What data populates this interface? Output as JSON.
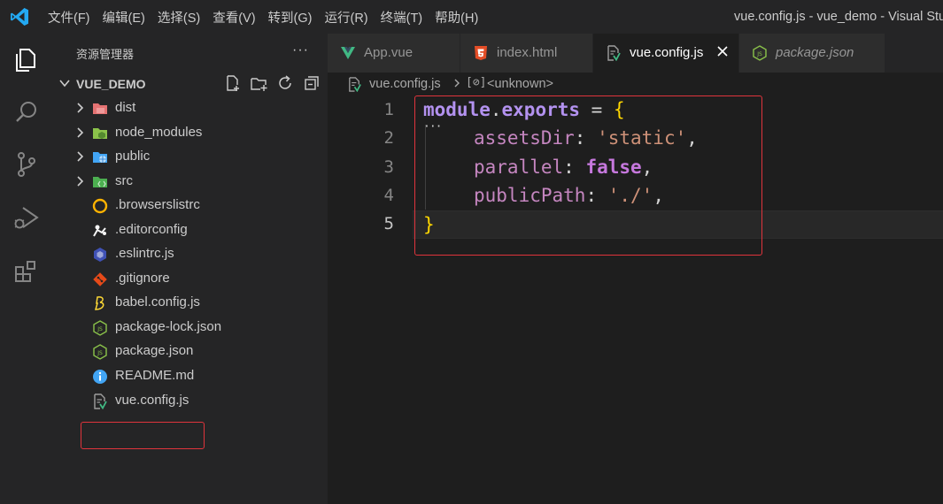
{
  "titlebar": {
    "menu": [
      "文件(F)",
      "编辑(E)",
      "选择(S)",
      "查看(V)",
      "转到(G)",
      "运行(R)",
      "终端(T)",
      "帮助(H)"
    ],
    "window_title": "vue.config.js - vue_demo - Visual Studio"
  },
  "sidebar": {
    "header": "资源管理器",
    "more": "···",
    "folder": "VUE_DEMO",
    "items": [
      {
        "label": "dist",
        "icon": "dist-folder-icon"
      },
      {
        "label": "node_modules",
        "icon": "node-modules-folder-icon"
      },
      {
        "label": "public",
        "icon": "public-folder-icon"
      },
      {
        "label": "src",
        "icon": "src-folder-icon"
      },
      {
        "label": ".browserslistrc",
        "icon": "browserslist-icon"
      },
      {
        "label": ".editorconfig",
        "icon": "editorconfig-icon"
      },
      {
        "label": ".eslintrc.js",
        "icon": "eslint-icon"
      },
      {
        "label": ".gitignore",
        "icon": "git-icon"
      },
      {
        "label": "babel.config.js",
        "icon": "babel-icon"
      },
      {
        "label": "package-lock.json",
        "icon": "nodejs-icon"
      },
      {
        "label": "package.json",
        "icon": "nodejs-icon"
      },
      {
        "label": "README.md",
        "icon": "info-icon"
      },
      {
        "label": "vue.config.js",
        "icon": "vue-config-icon"
      }
    ]
  },
  "tabs": [
    {
      "label": "App.vue",
      "icon": "vue-icon",
      "active": false
    },
    {
      "label": "index.html",
      "icon": "html5-icon",
      "active": false
    },
    {
      "label": "vue.config.js",
      "icon": "vue-config-icon",
      "active": true
    },
    {
      "label": "package.json",
      "icon": "nodejs-icon",
      "active": false,
      "italic": true
    }
  ],
  "breadcrumb": {
    "file": "vue.config.js",
    "symbol_glyph": "[⊘]",
    "symbol": "<unknown>"
  },
  "editor": {
    "line_numbers": [
      "1",
      "2",
      "3",
      "4",
      "5"
    ],
    "current_line": "5",
    "code": {
      "l1_module": "module",
      "l1_dot": ".",
      "l1_exports": "exports",
      "l1_eq": " = ",
      "l1_brace": "{",
      "l2_key": "assetsDir",
      "l2_colon": ": ",
      "l2_val": "'static'",
      "l2_comma": ",",
      "l3_key": "parallel",
      "l3_colon": ": ",
      "l3_val": "false",
      "l3_comma": ",",
      "l4_key": "publicPath",
      "l4_colon": ": ",
      "l4_val": "'./'",
      "l4_comma": ",",
      "l5_brace": "}"
    },
    "fold_dots": "···"
  },
  "colors": {
    "highlight_box": "#e0343c",
    "background": "#1e1e1e",
    "sidebar": "#252526"
  }
}
